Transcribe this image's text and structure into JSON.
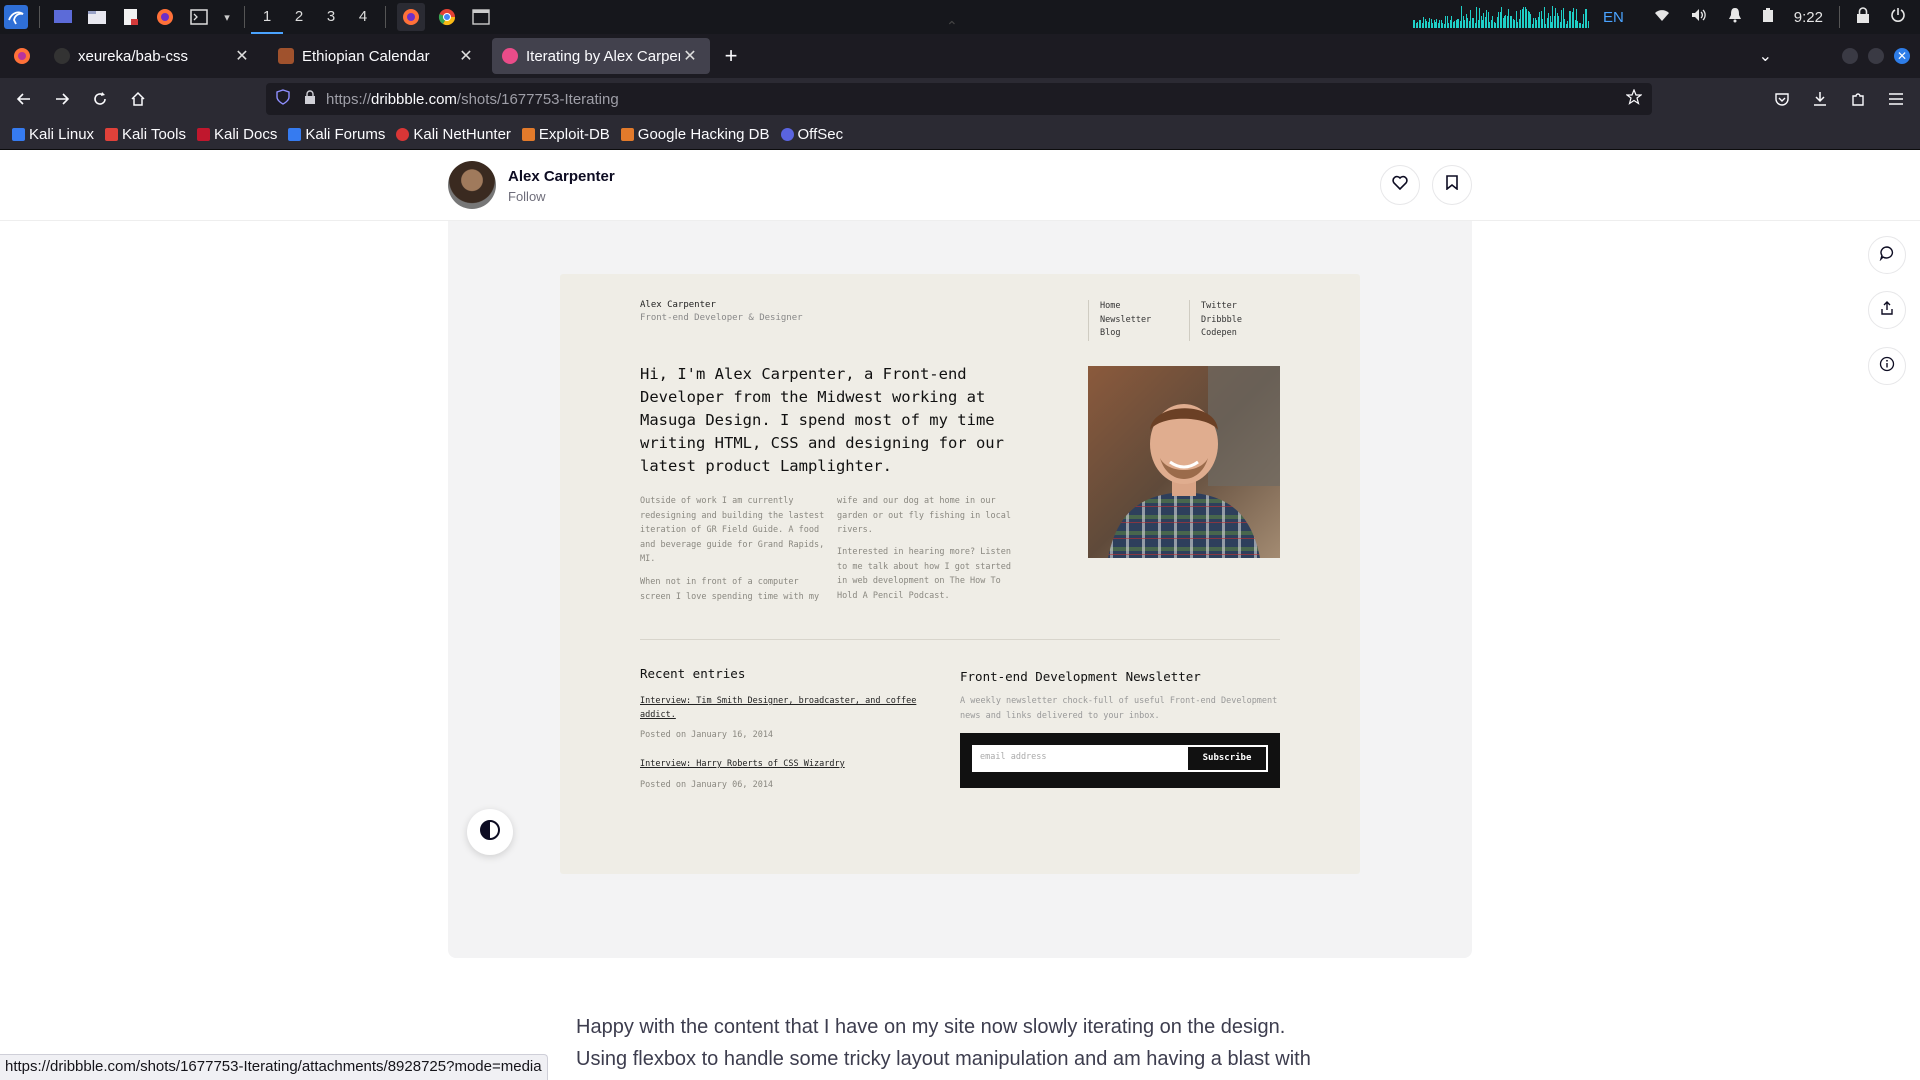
{
  "taskbar": {
    "workspaces": [
      "1",
      "2",
      "3",
      "4"
    ],
    "active_workspace": "1",
    "language": "EN",
    "time": "9:22",
    "icons": [
      "kali-menu-icon",
      "desktop-icon",
      "file-manager-icon",
      "text-editor-icon",
      "firefox-icon",
      "terminal-icon"
    ]
  },
  "tabs": [
    {
      "title": "xeureka/bab-css",
      "icon": "github-icon",
      "active": false
    },
    {
      "title": "Ethiopian Calendar",
      "icon": "calendar-icon",
      "active": false
    },
    {
      "title": "Iterating by Alex Carpenter",
      "icon": "dribbble-icon",
      "active": true
    }
  ],
  "urlbar": {
    "prefix": "https://",
    "domain": "dribbble.com",
    "path": "/shots/1677753-Iterating"
  },
  "bookmarks": [
    "Kali Linux",
    "Kali Tools",
    "Kali Docs",
    "Kali Forums",
    "Kali NetHunter",
    "Exploit-DB",
    "Google Hacking DB",
    "OffSec"
  ],
  "shot": {
    "author": "Alex Carpenter",
    "follow_label": "Follow"
  },
  "design": {
    "name": "Alex Carpenter",
    "role": "Front-end Developer & Designer",
    "nav_left": [
      "Home",
      "Newsletter",
      "Blog"
    ],
    "nav_right": [
      "Twitter",
      "Dribbble",
      "Codepen"
    ],
    "intro": "Hi, I'm Alex Carpenter, a Front-end Developer from the Midwest working at Masuga Design. I spend most of my time writing HTML, CSS and designing for our latest product Lamplighter.",
    "col1_p1": "Outside of work I am currently redesigning and building the lastest iteration of GR Field Guide. A food and beverage guide for Grand Rapids, MI.",
    "col1_p2": "When not in front of a computer screen I love spending time with my",
    "col2_p1": "wife and our dog at home in our garden or out fly fishing in local rivers.",
    "col2_p2": "Interested in hearing more? Listen to me talk about how I got started in web development on The How To Hold A Pencil Podcast.",
    "recent_heading": "Recent entries",
    "entries": [
      {
        "title": "Interview: Tim Smith Designer, broadcaster, and coffee addict.",
        "date": "Posted on January 16, 2014"
      },
      {
        "title": "Interview: Harry Roberts of CSS Wizardry",
        "date": "Posted on January 06, 2014"
      }
    ],
    "newsletter_heading": "Front-end Development Newsletter",
    "newsletter_desc": "A weekly newsletter chock-full of useful Front-end Development news and links delivered to your inbox.",
    "email_placeholder": "email address",
    "subscribe_label": "Subscribe"
  },
  "description": {
    "line1": "Happy with the content that I have on my site now slowly iterating on the design.",
    "line2": "Using flexbox to handle some tricky layout manipulation and am having a blast with"
  },
  "status_bar_url": "https://dribbble.com/shots/1677753-Iterating/attachments/8928725?mode=media",
  "colors": {
    "panel_bg": "#16171c",
    "tabstrip_bg": "#1c1b22",
    "toolbar_bg": "#2b2a33",
    "accent": "#4aa3ff",
    "design_bg": "#efede6"
  }
}
